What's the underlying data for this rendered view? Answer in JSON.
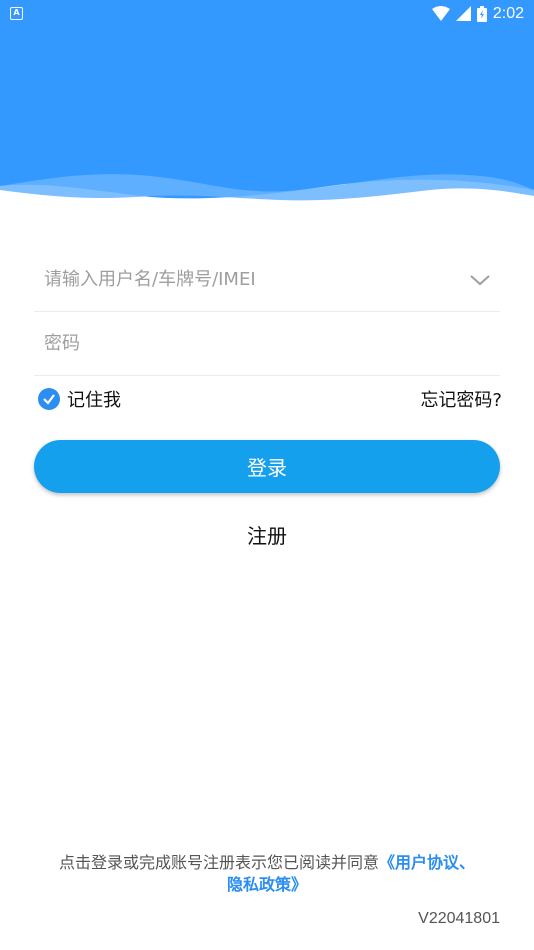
{
  "status_bar": {
    "time": "2:02",
    "notification_icon": "A"
  },
  "form": {
    "username_placeholder": "请输入用户名/车牌号/IMEI",
    "password_placeholder": "密码",
    "remember_label": "记住我",
    "remember_checked": true,
    "forgot_label": "忘记密码?"
  },
  "actions": {
    "login_label": "登录",
    "register_label": "注册"
  },
  "footer": {
    "agreement_text": "点击登录或完成账号注册表示您已阅读并同意",
    "agreement_link_1": "《用户协议、",
    "agreement_link_2": "隐私政策》",
    "version": "V22041801"
  },
  "colors": {
    "header": "#3399ff",
    "button": "#14a0ec",
    "link": "#2b8ef0"
  }
}
